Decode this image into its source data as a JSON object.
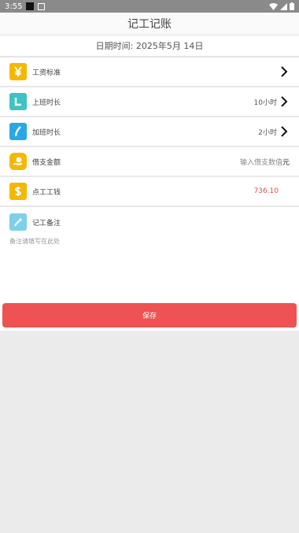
{
  "status": {
    "time": "3:55"
  },
  "header": {
    "title": "记工记账"
  },
  "date": {
    "text": "日期时间: 2025年5月 14日"
  },
  "rows": [
    {
      "label": "工资标准",
      "value": "",
      "icon": "yen-icon",
      "color": "#f5b800"
    },
    {
      "label": "上班时长",
      "value": "10小时",
      "icon": "clock-l-icon",
      "color": "#3fc2c4"
    },
    {
      "label": "加班时长",
      "value": "2小时",
      "icon": "moon-icon",
      "color": "#2aa7e8"
    },
    {
      "label": "借支金额",
      "placeholder": "输入借支数值",
      "unit": "元",
      "icon": "hand-coin-icon",
      "color": "#f5b800"
    },
    {
      "label": "点工工钱",
      "value": "736.10",
      "icon": "dollar-icon",
      "color": "#f5b800"
    }
  ],
  "notes": {
    "label": "记工备注",
    "placeholder": "备注请填写在此处",
    "icon": "pencil-icon",
    "color": "#7dd0ea"
  },
  "save": {
    "label": "保存",
    "color": "#ee5252"
  }
}
